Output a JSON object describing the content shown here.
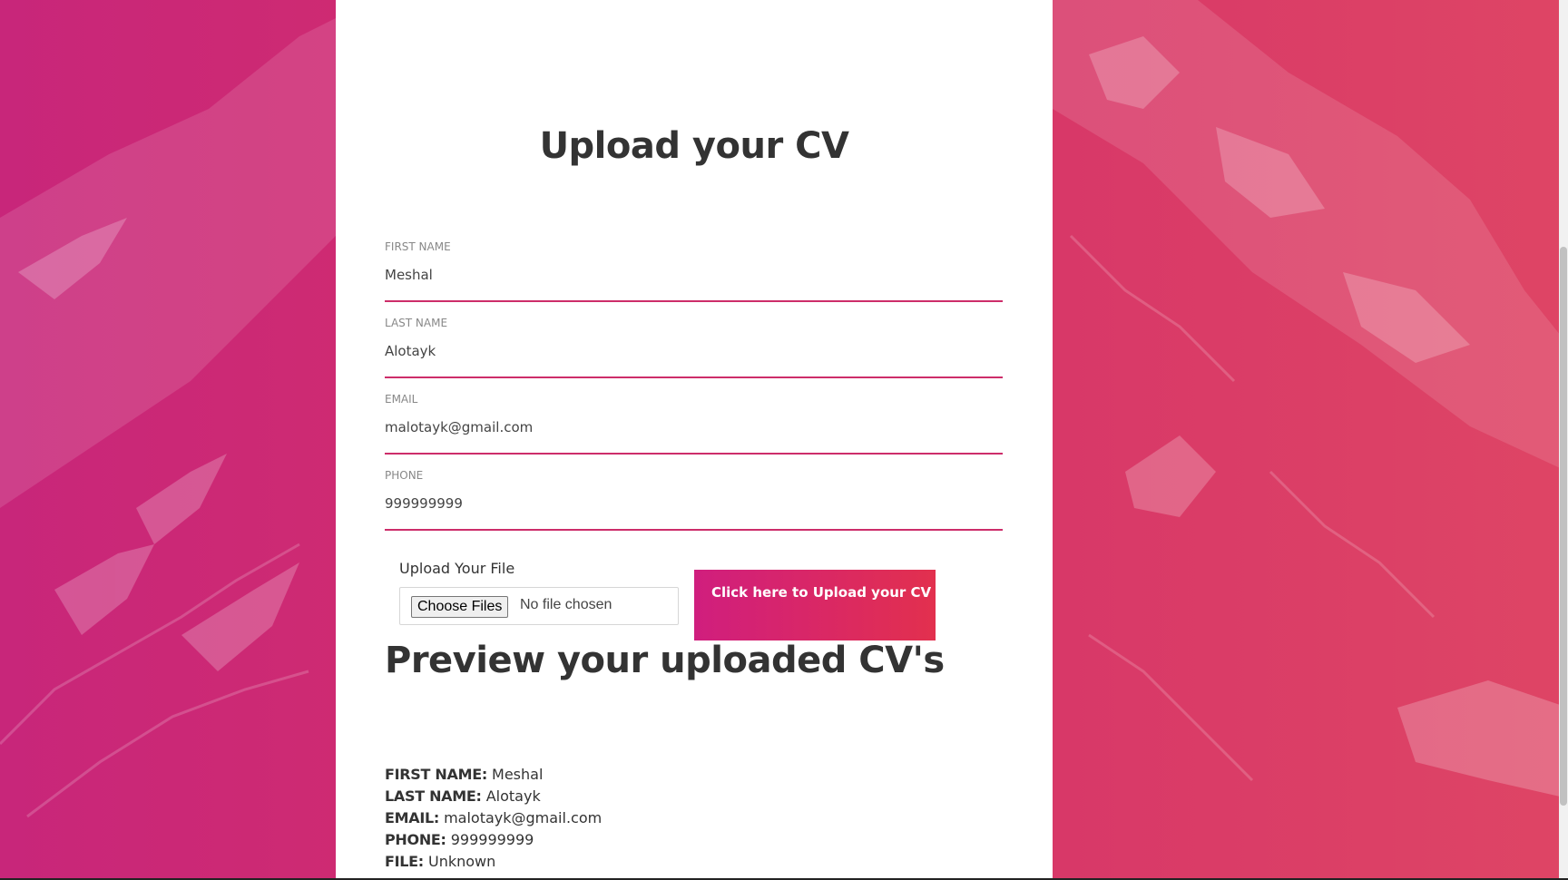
{
  "colors": {
    "accent_start": "#d01e7e",
    "accent_end": "#e2304e",
    "field_underline": "#cd2d6a",
    "background_left": "#c8267a",
    "background_right": "#de4565"
  },
  "page": {
    "title": "Upload your CV"
  },
  "form": {
    "first_name": {
      "label": "FIRST NAME",
      "value": "Meshal"
    },
    "last_name": {
      "label": "LAST NAME",
      "value": "Alotayk"
    },
    "email": {
      "label": "EMAIL",
      "value": "malotayk@gmail.com"
    },
    "phone": {
      "label": "PHONE",
      "value": "999999999"
    },
    "upload": {
      "label": "Upload Your File",
      "button_label": "Choose Files",
      "status": "No file chosen"
    },
    "submit_label": "Click here to Upload your CV"
  },
  "preview": {
    "title": "Preview your uploaded CV's",
    "rows": [
      {
        "key": "FIRST NAME:",
        "value": " Meshal"
      },
      {
        "key": "LAST NAME:",
        "value": " Alotayk"
      },
      {
        "key": "EMAIL:",
        "value": " malotayk@gmail.com"
      },
      {
        "key": "PHONE:",
        "value": " 999999999"
      },
      {
        "key": "FILE:",
        "value": " Unknown"
      }
    ]
  }
}
